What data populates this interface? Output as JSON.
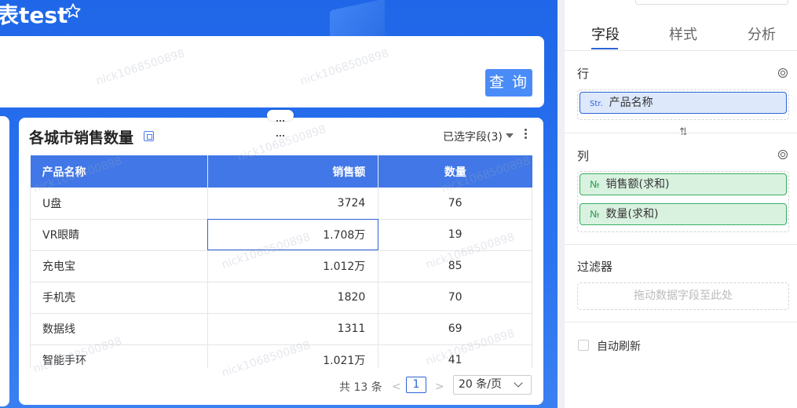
{
  "dashboard": {
    "title": "表test",
    "query_label": "查 询",
    "watermark": "nick1068500898"
  },
  "chart_card": {
    "title": "各城市销售数量",
    "field_selector": "已选字段(3)",
    "columns": [
      "产品名称",
      "销售额",
      "数量"
    ],
    "rows": [
      [
        "U盘",
        "3724",
        "76"
      ],
      [
        "VR眼睛",
        "1.708万",
        "19"
      ],
      [
        "充电宝",
        "1.012万",
        "85"
      ],
      [
        "手机壳",
        "1820",
        "70"
      ],
      [
        "数据线",
        "1311",
        "69"
      ],
      [
        "智能手环",
        "1.021万",
        "41"
      ]
    ],
    "pagination": {
      "total": "共 13 条",
      "prev": "<",
      "current_page": "1",
      "next": ">",
      "page_size": "20 条/页"
    }
  },
  "panel": {
    "tabs": [
      {
        "label": "字段",
        "active": true
      },
      {
        "label": "样式",
        "active": false
      },
      {
        "label": "分析",
        "active": false
      }
    ],
    "rows_section": {
      "label": "行",
      "fields": [
        {
          "tag": "Str.",
          "name": "产品名称"
        }
      ]
    },
    "swap_symbol": "⇅",
    "columns_section": {
      "label": "列",
      "fields": [
        {
          "tag": "№",
          "name": "销售额(求和)"
        },
        {
          "tag": "№",
          "name": "数量(求和)"
        }
      ]
    },
    "filter_section": {
      "label": "过滤器",
      "placeholder": "拖动数据字段至此处"
    },
    "auto_refresh_label": "自动刷新",
    "auto_refresh_checked": false
  },
  "colors": {
    "header_blue": "#4177e6",
    "accent": "#2f63d6",
    "measure_green": "#3aac62",
    "background_blue": "#2b73ef"
  }
}
